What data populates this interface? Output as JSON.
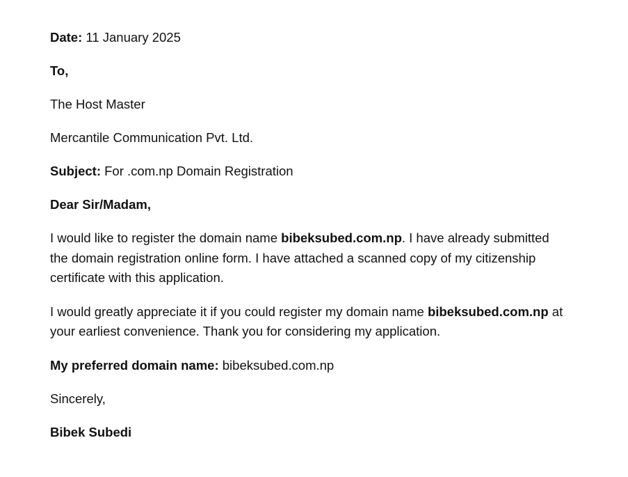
{
  "letter": {
    "date_label": "Date:",
    "date_value": "11 January 2025",
    "to": "To,",
    "recipient_title": "The Host Master",
    "recipient_org": "Mercantile Communication Pvt. Ltd.",
    "subject_label": "Subject:",
    "subject_value": "For .com.np Domain Registration",
    "salutation": "Dear Sir/Madam,",
    "para1": {
      "line1_a": "I would like to register the domain name ",
      "domain": "bibeksubed.com.np",
      "line1_b": ". I have already submitted",
      "line2": "the domain registration online form. I have attached a scanned copy of my citizenship",
      "line3": "certificate with this application."
    },
    "para2": {
      "line1_a": "I would greatly appreciate it if you could register my domain name ",
      "domain": "bibeksubed.com.np",
      "line1_b": " at",
      "line2": "your earliest convenience. Thank you for considering my application."
    },
    "preferred_label": "My preferred domain name:",
    "preferred_value": "bibeksubed.com.np",
    "closing": "Sincerely,",
    "signature": "Bibek Subedi"
  }
}
